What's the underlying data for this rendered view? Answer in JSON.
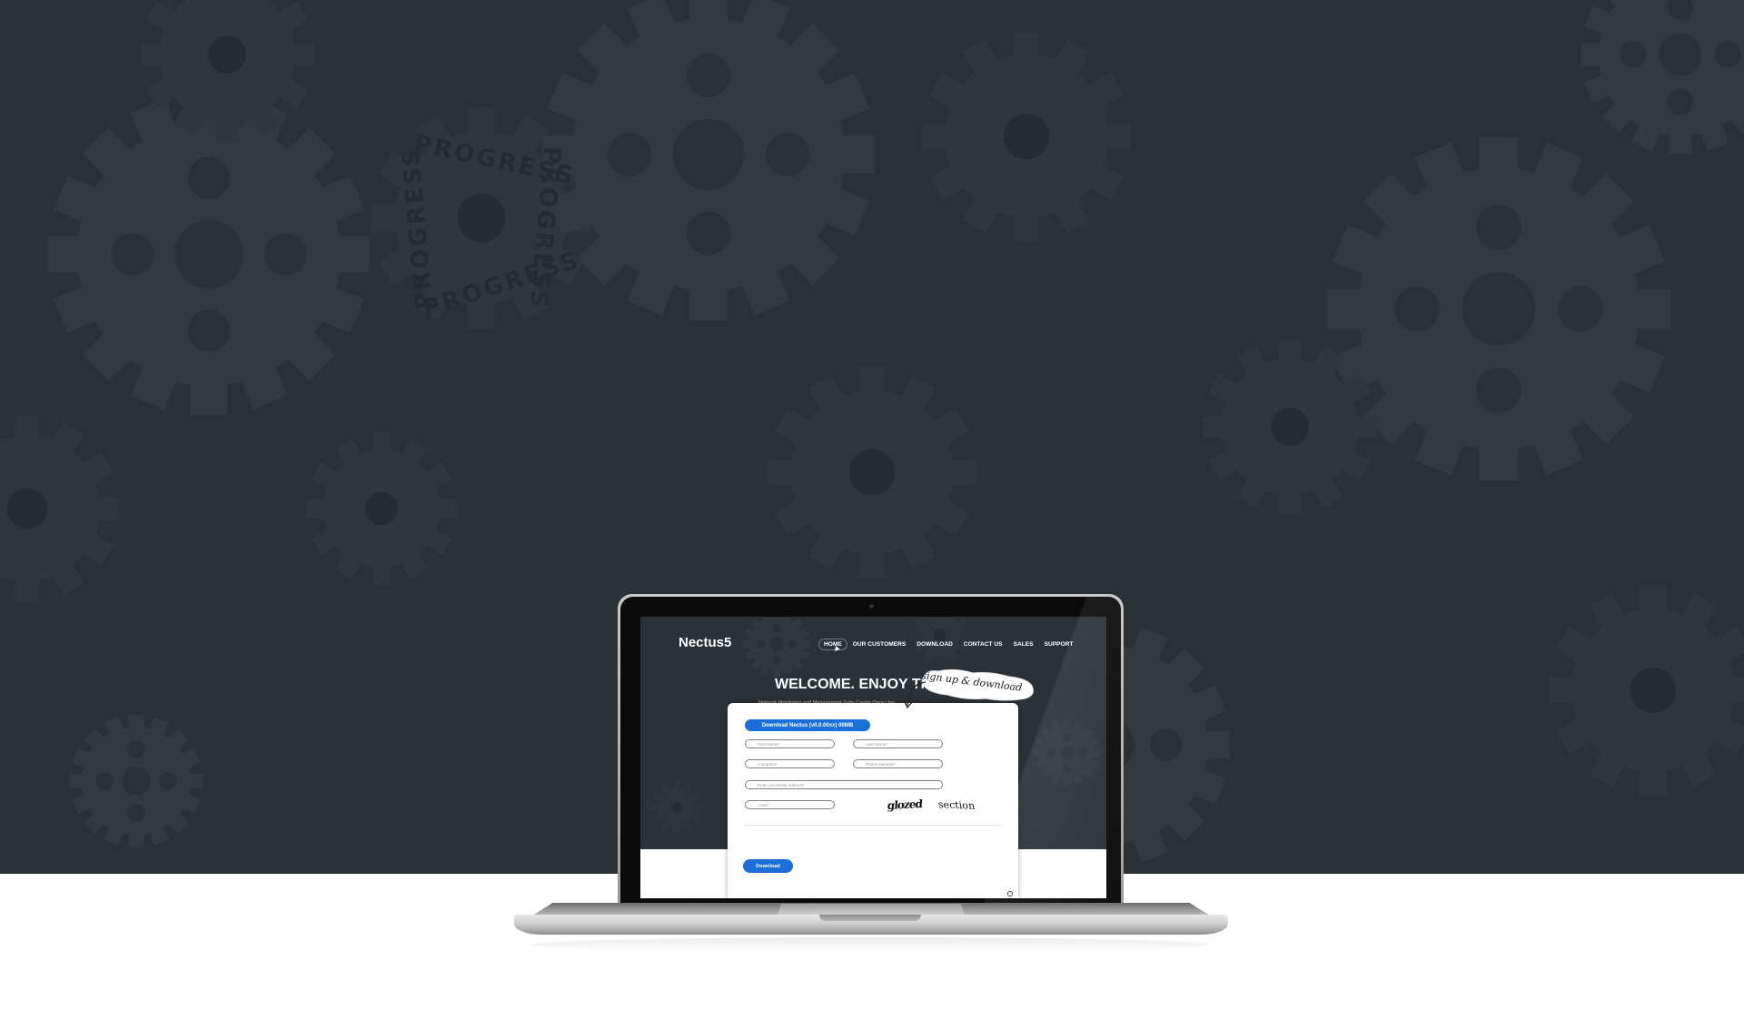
{
  "background": {
    "gear_stamp_text": "PROGRESS"
  },
  "site": {
    "logo": "Nectus5",
    "nav": [
      {
        "label": "HOME",
        "active": true
      },
      {
        "label": "OUR CUSTOMERS"
      },
      {
        "label": "DOWNLOAD"
      },
      {
        "label": "CONTACT US"
      },
      {
        "label": "SALES"
      },
      {
        "label": "SUPPORT"
      }
    ],
    "hero_title": "WELCOME. ENJOY THE TOOL",
    "hero_subtitle": "Network Monitoring and Management Suite Create Once Use"
  },
  "form": {
    "top_button": "Download Nectus (v0.0.00xx) 00MB",
    "first_name_placeholder": "First Name*",
    "last_name_placeholder": "Last Name*",
    "company_placeholder": "Company*",
    "phone_placeholder": "Phone Number*",
    "email_placeholder": "Enter you Email address*",
    "code_placeholder": "Code*",
    "captcha_word1": "glozed",
    "captcha_word2": "section",
    "submit_button": "Download"
  },
  "callout": {
    "text": "sign up & download"
  },
  "colors": {
    "page_bg": "#2a3135",
    "accent_blue": "#1b6fd9",
    "floor": "#ffffff"
  }
}
